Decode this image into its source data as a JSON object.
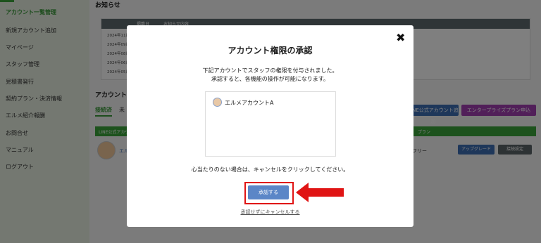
{
  "sidebar": {
    "items": [
      {
        "label": "アカウント一覧管理",
        "active": true
      },
      {
        "label": "新規アカウント追加"
      },
      {
        "label": "マイページ"
      },
      {
        "label": "スタッフ管理"
      },
      {
        "label": "見積書発行"
      },
      {
        "label": "契約プラン・決済情報"
      },
      {
        "label": "エルメ紹介報酬"
      },
      {
        "label": "お問合せ"
      },
      {
        "label": "マニュアル"
      },
      {
        "label": "ログアウト"
      }
    ]
  },
  "main": {
    "notice_title": "お知らせ",
    "notice_head_date": "掲載日",
    "notice_head_title": "お知らせ内容",
    "notice_rows": [
      "2024年11月",
      "2024年09月",
      "2024年08月",
      "2024年06月",
      "2024年05月"
    ],
    "account_title": "アカウント一",
    "tab_active": "接続済",
    "tab_other": "未",
    "btn_add_account": "LINE公式アカウント追加",
    "btn_enterprise": "エンタープライズプラン申込",
    "green_head_left": "LINE公式アカウ",
    "green_head_right": "プラン",
    "row_link": "エル",
    "row_plan": "フリー",
    "btn_upgrade": "アップグレード",
    "btn_settings": "接続設定"
  },
  "modal": {
    "title": "アカウント権限の承認",
    "desc_line1": "下記アカウントでスタッフの権限を付与されました。",
    "desc_line2": "承認すると、各機能の操作が可能になります。",
    "account_name": "エルメアカウントA",
    "note": "心当たりのない場合は、キャンセルをクリックしてください。",
    "approve_label": "承認する",
    "cancel_label": "承認せずにキャンセルする",
    "close_symbol": "✖"
  },
  "colors": {
    "accent_green": "#3aa53a",
    "primary_blue": "#5b86c7",
    "highlight_red": "#e01414"
  }
}
